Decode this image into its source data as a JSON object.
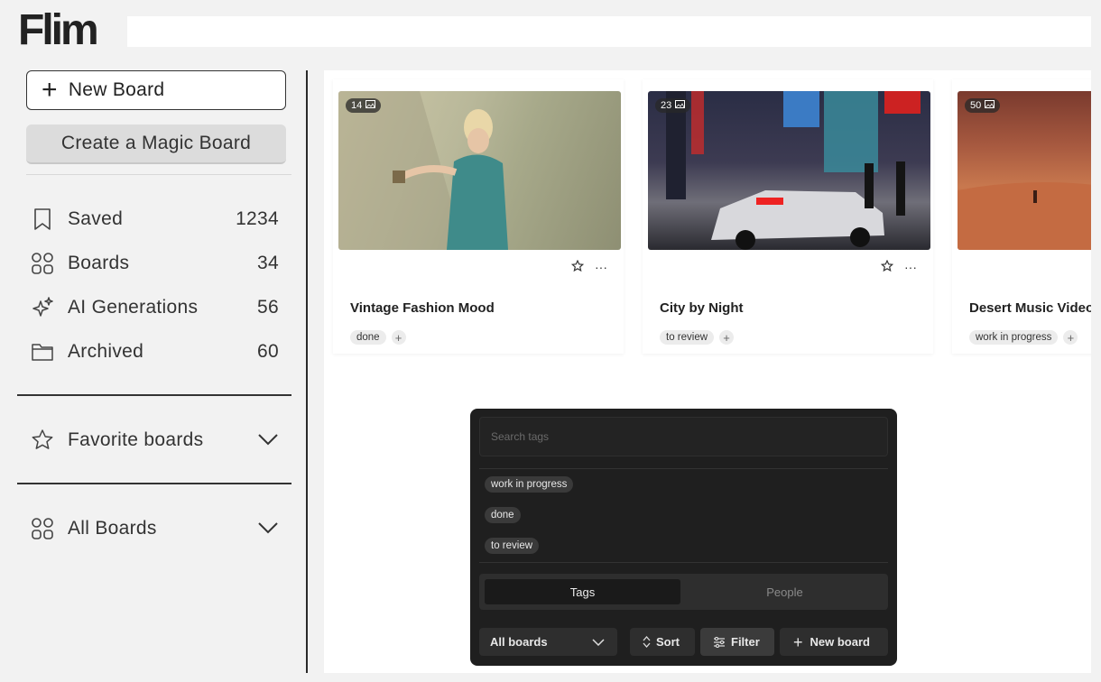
{
  "brand": {
    "logo": "Flim"
  },
  "sidebar": {
    "new_board": "New Board",
    "magic_board": "Create a Magic Board",
    "nav": [
      {
        "label": "Saved",
        "count": "1234",
        "icon": "bookmark-icon"
      },
      {
        "label": "Boards",
        "count": "34",
        "icon": "grid-icon"
      },
      {
        "label": "AI Generations",
        "count": "56",
        "icon": "sparkles-icon"
      },
      {
        "label": "Archived",
        "count": "60",
        "icon": "folder-icon"
      }
    ],
    "favorite_boards": "Favorite boards",
    "all_boards": "All Boards"
  },
  "boards": [
    {
      "title": "Vintage Fashion Mood",
      "count": "14",
      "tags": [
        "done"
      ]
    },
    {
      "title": "City by Night",
      "count": "23",
      "tags": [
        "to review"
      ]
    },
    {
      "title": "Desert Music Video",
      "count": "50",
      "tags": [
        "work in progress"
      ]
    }
  ],
  "popup": {
    "search_placeholder": "Search tags",
    "tags": [
      "work in progress",
      "done",
      "to review"
    ],
    "tabs": [
      "Tags",
      "People"
    ],
    "all_boards": "All boards",
    "sort": "Sort",
    "filter": "Filter",
    "new_board": "New board"
  },
  "colors": {
    "popup_bg": "#1f1f1f",
    "sidebar_bg": "#f2f2f2",
    "accent_dark": "#222222"
  }
}
